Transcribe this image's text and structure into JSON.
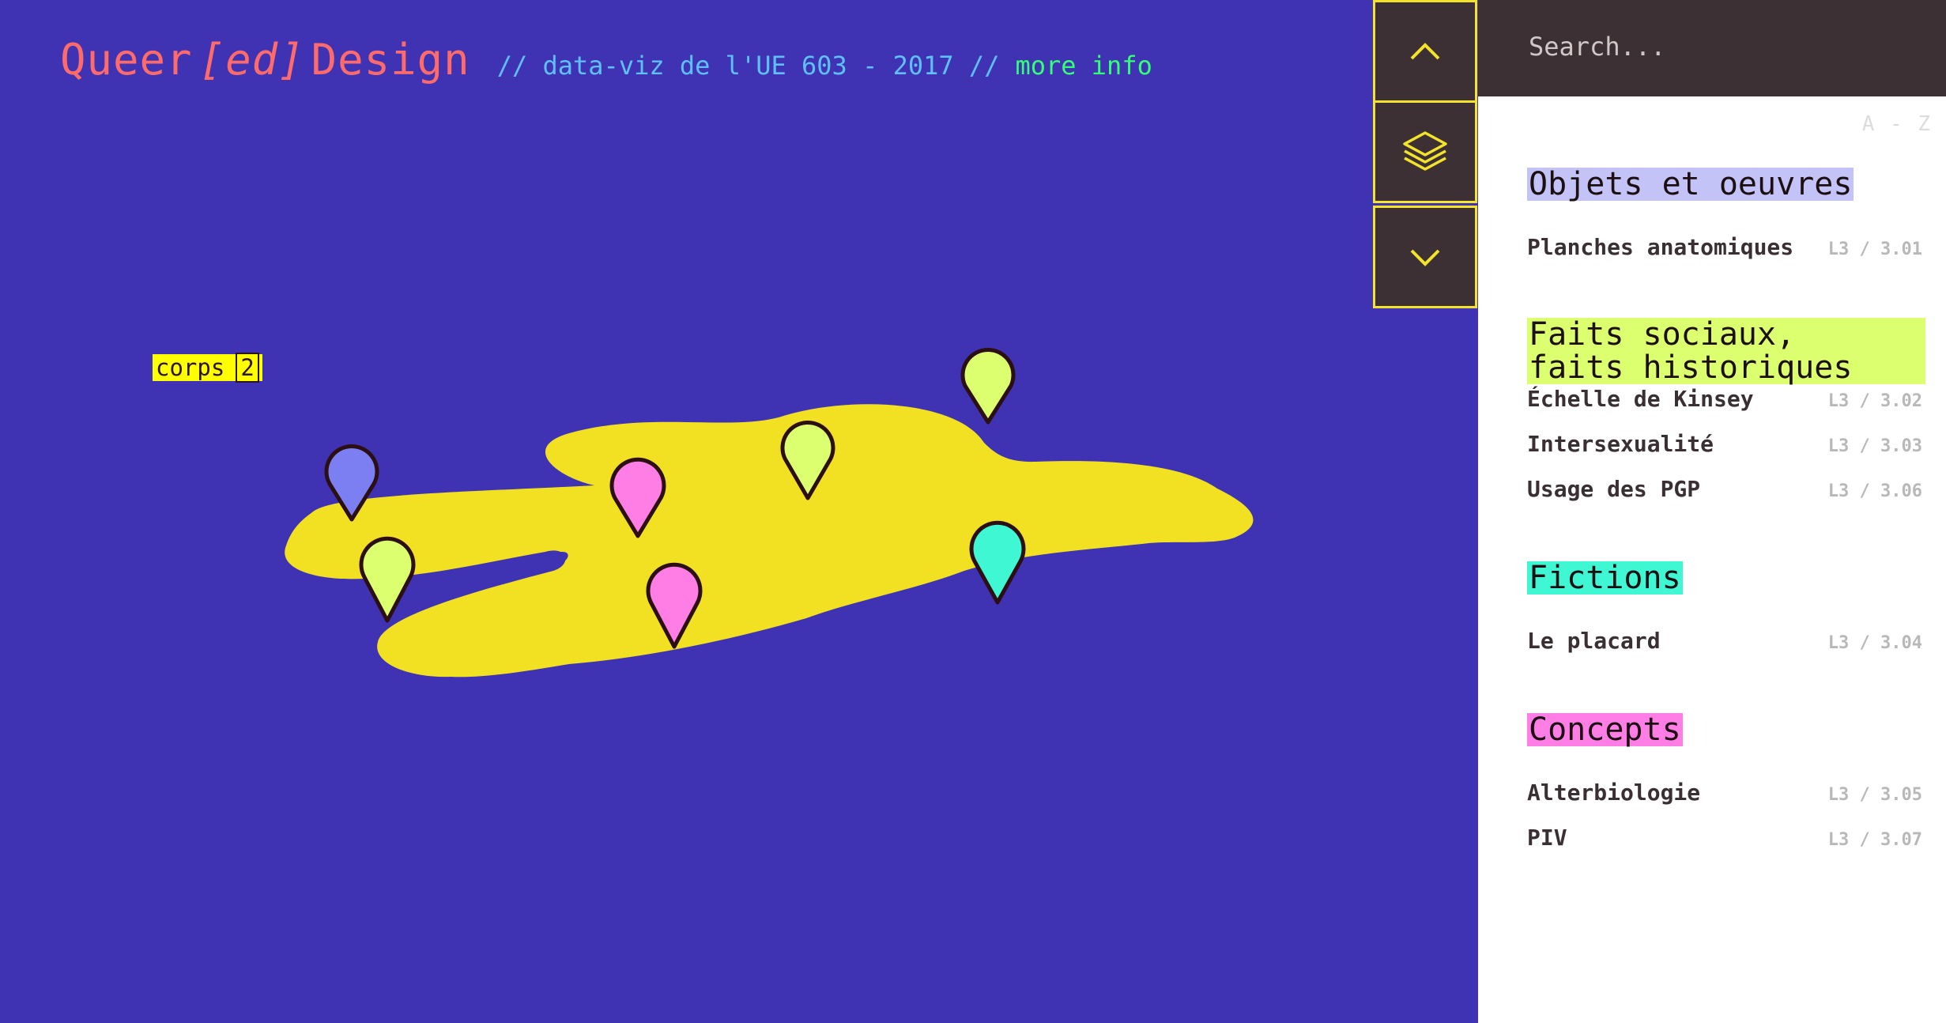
{
  "header": {
    "title_main": "Queer",
    "title_ed": "[ed]",
    "title_end": "Design",
    "subtitle": "// data-viz de l'UE 603 - 2017 //",
    "more_info": "more info"
  },
  "map": {
    "cluster": {
      "label": "corps",
      "count": "2"
    },
    "blob_color": "#f2e022",
    "markers": [
      {
        "name": "marker-blue",
        "color": "#7b7ff2"
      },
      {
        "name": "marker-lime-left",
        "color": "#dcff6f"
      },
      {
        "name": "marker-pink-upper",
        "color": "#ff7ee6"
      },
      {
        "name": "marker-pink-lower",
        "color": "#ff7ee6"
      },
      {
        "name": "marker-lime-center",
        "color": "#dcff6f"
      },
      {
        "name": "marker-lime-top",
        "color": "#dcff6f"
      },
      {
        "name": "marker-teal",
        "color": "#3ff7d2"
      }
    ]
  },
  "nav": {
    "up_icon": "chevron-up-icon",
    "layers_icon": "layers-icon",
    "down_icon": "chevron-down-icon",
    "accent": "#f3e32a"
  },
  "sidebar": {
    "search_placeholder": "Search...",
    "sort_label": "A - Z",
    "sections": [
      {
        "title": "Objets et oeuvres",
        "color": "#c3c3f7",
        "items": [
          {
            "name": "Planches anatomiques",
            "code": "L3 / 3.01"
          }
        ]
      },
      {
        "title": "Faits sociaux,\nfaits historiques",
        "color": "#dcff6f",
        "items": [
          {
            "name": "Échelle de Kinsey",
            "code": "L3 / 3.02"
          },
          {
            "name": "Intersexualité",
            "code": "L3 / 3.03"
          },
          {
            "name": "Usage des PGP",
            "code": "L3 / 3.06"
          }
        ]
      },
      {
        "title": "Fictions",
        "color": "#3ff7d2",
        "items": [
          {
            "name": "Le placard",
            "code": "L3 / 3.04"
          }
        ]
      },
      {
        "title": "Concepts",
        "color": "#ff7ee6",
        "items": [
          {
            "name": "Alterbiologie",
            "code": "L3 / 3.05"
          },
          {
            "name": "PIV",
            "code": "L3 / 3.07"
          }
        ]
      }
    ]
  }
}
